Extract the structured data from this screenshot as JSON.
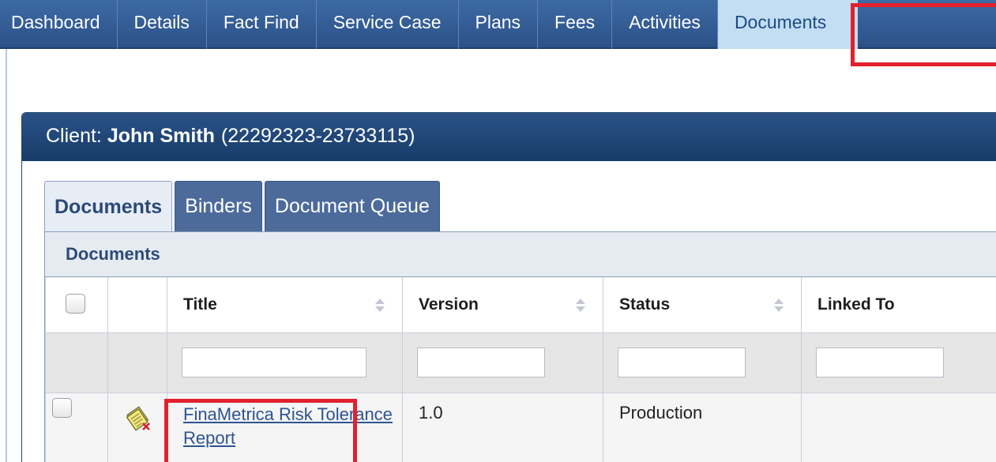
{
  "topnav": {
    "tabs": [
      {
        "label": "Dashboard"
      },
      {
        "label": "Details"
      },
      {
        "label": "Fact Find"
      },
      {
        "label": "Service Case"
      },
      {
        "label": "Plans"
      },
      {
        "label": "Fees"
      },
      {
        "label": "Activities"
      },
      {
        "label": "Documents",
        "active": true
      }
    ]
  },
  "client": {
    "prefix": "Client: ",
    "name": "John Smith",
    "id": "(22292323-23733115)"
  },
  "subtabs": [
    {
      "label": "Documents",
      "active": true
    },
    {
      "label": "Binders"
    },
    {
      "label": "Document Queue"
    }
  ],
  "grid": {
    "caption": "Documents",
    "columns": [
      "Title",
      "Version",
      "Status",
      "Linked To"
    ],
    "filters": {
      "title": "",
      "version": "",
      "status": "",
      "linked_to": ""
    },
    "rows": [
      {
        "icon": "document-deleted-icon",
        "title": "FinaMetrica Risk Tolerance Report",
        "version": "1.0",
        "status": "Production",
        "linked_to": ""
      }
    ]
  },
  "colors": {
    "nav_bg": "#2c5189",
    "nav_active_bg": "#c3ddf2",
    "panel_header_bg": "#173c6a",
    "highlight": "#e3202e",
    "link": "#2d548f"
  }
}
